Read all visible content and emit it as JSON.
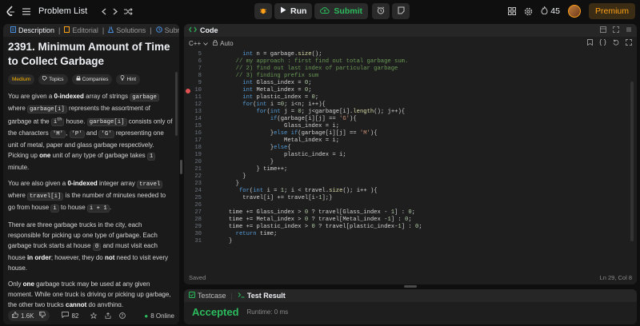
{
  "topbar": {
    "title": "Problem List",
    "run_label": "Run",
    "submit_label": "Submit",
    "streak": "45",
    "premium_label": "Premium"
  },
  "left": {
    "tabs": [
      {
        "label": "Description"
      },
      {
        "label": "Editorial"
      },
      {
        "label": "Solutions"
      },
      {
        "label": "Submissio"
      }
    ],
    "title": "2391. Minimum Amount of Time to Collect Garbage",
    "pills": {
      "difficulty": "Medium",
      "topics": "Topics",
      "companies": "Companies",
      "hint": "Hint"
    },
    "footer": {
      "likes": "1.6K",
      "comments": "82",
      "online": "8 Online"
    }
  },
  "code": {
    "tab_label": "Code",
    "language": "C++",
    "mode": "Auto",
    "status_left": "Saved",
    "status_right": "Ln 29, Col 8",
    "lines": [
      {
        "n": "5",
        "t": ""
      },
      {
        "n": "6",
        "t": ""
      },
      {
        "n": "7",
        "t": ""
      },
      {
        "n": "8",
        "t": ""
      },
      {
        "n": "9",
        "t": ""
      },
      {
        "n": "10",
        "t": "",
        "bp": true
      },
      {
        "n": "11",
        "t": ""
      },
      {
        "n": "12",
        "t": ""
      },
      {
        "n": "13",
        "t": ""
      },
      {
        "n": "14",
        "t": ""
      },
      {
        "n": "15",
        "t": ""
      },
      {
        "n": "16",
        "t": ""
      },
      {
        "n": "17",
        "t": ""
      },
      {
        "n": "18",
        "t": ""
      },
      {
        "n": "19",
        "t": ""
      },
      {
        "n": "20",
        "t": ""
      },
      {
        "n": "21",
        "t": ""
      },
      {
        "n": "22",
        "t": ""
      },
      {
        "n": "23",
        "t": ""
      },
      {
        "n": "24",
        "t": ""
      },
      {
        "n": "25",
        "t": ""
      },
      {
        "n": "26",
        "t": ""
      },
      {
        "n": "27",
        "t": ""
      },
      {
        "n": "28",
        "t": ""
      },
      {
        "n": "29",
        "t": ""
      },
      {
        "n": "30",
        "t": ""
      },
      {
        "n": "31",
        "t": ""
      }
    ]
  },
  "test": {
    "tab_testcase": "Testcase",
    "tab_result": "Test Result",
    "status": "Accepted",
    "runtime": "Runtime: 0 ms"
  },
  "colors": {
    "accent": "#ffa116",
    "success": "#2cbb5d",
    "medium": "#ffb800"
  }
}
